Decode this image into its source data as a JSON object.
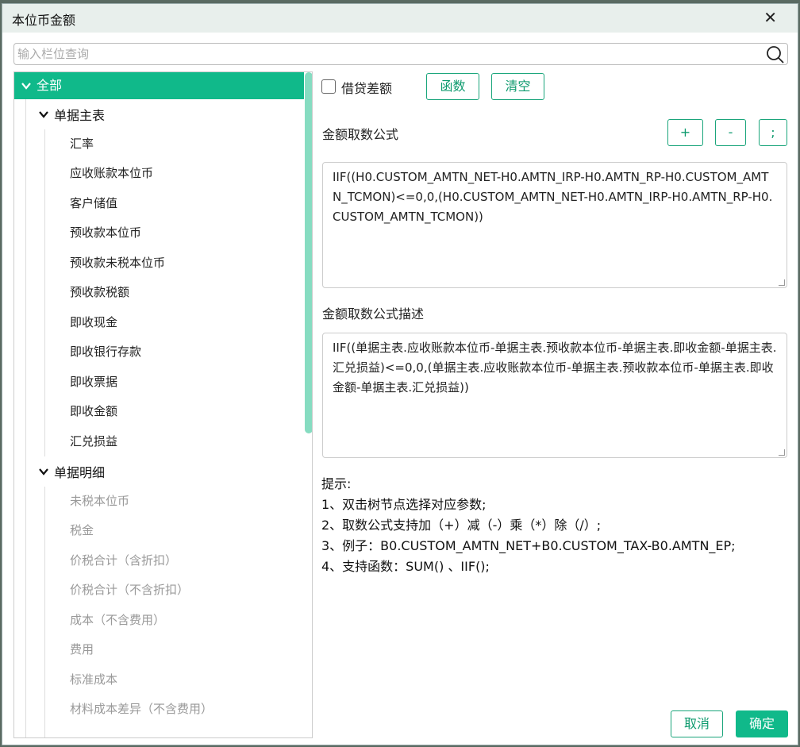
{
  "dialog": {
    "title": "本位币金额",
    "close_icon": "close-icon"
  },
  "search": {
    "placeholder": "输入栏位查询",
    "icon": "search-icon"
  },
  "tree": {
    "root_label": "全部",
    "groups": [
      {
        "label": "单据主表",
        "items": [
          "汇率",
          "应收账款本位币",
          "客户储值",
          "预收款本位币",
          "预收款未税本位币",
          "预收款税额",
          "即收现金",
          "即收银行存款",
          "即收票据",
          "即收金额",
          "汇兑损益"
        ]
      },
      {
        "label": "单据明细",
        "items": [
          "未税本位币",
          "税金",
          "价税合计（含折扣）",
          "价税合计（不含折扣）",
          "成本（不含费用）",
          "费用",
          "标准成本",
          "材料成本差异（不含费用）"
        ]
      }
    ]
  },
  "toolbar": {
    "checkbox_label": "借贷差额",
    "func_label": "函数",
    "clear_label": "清空",
    "plus_label": "+",
    "minus_label": "-",
    "semicolon_label": ";"
  },
  "formula": {
    "label": "金额取数公式",
    "value": "IIF((H0.CUSTOM_AMTN_NET-H0.AMTN_IRP-H0.AMTN_RP-H0.CUSTOM_AMTN_TCMON)<=0,0,(H0.CUSTOM_AMTN_NET-H0.AMTN_IRP-H0.AMTN_RP-H0.CUSTOM_AMTN_TCMON))"
  },
  "description": {
    "label": "金额取数公式描述",
    "value": "IIF((单据主表.应收账款本位币-单据主表.预收款本位币-单据主表.即收金额-单据主表.汇兑损益)<=0,0,(单据主表.应收账款本位币-单据主表.预收款本位币-单据主表.即收金额-单据主表.汇兑损益))"
  },
  "tips": {
    "title": "提示:",
    "lines": [
      "1、双击树节点选择对应参数;",
      "2、取数公式支持加（+）减（-）乘（*）除（/）;",
      "3、例子：B0.CUSTOM_AMTN_NET+B0.CUSTOM_TAX-B0.AMTN_EP;",
      "4、支持函数：SUM() 、IIF();"
    ]
  },
  "footer": {
    "cancel_label": "取消",
    "ok_label": "确定"
  },
  "colors": {
    "accent": "#10b98a",
    "accent_border": "#1aa57b",
    "scrollbar": "#86dcc1"
  }
}
